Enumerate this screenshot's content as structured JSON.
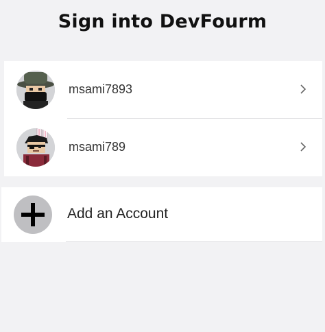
{
  "header": {
    "title": "Sign into DevFourm"
  },
  "accounts": [
    {
      "username": "msami7893",
      "avatar": "masked-avatar-with-hat"
    },
    {
      "username": "msami789",
      "avatar": "avatar-with-bunny-ears"
    }
  ],
  "add_account": {
    "label": "Add an Account",
    "icon": "plus-icon"
  },
  "icons": {
    "chevron": "chevron-right-icon"
  },
  "colors": {
    "background": "#f2f2f4",
    "card": "#ffffff",
    "separator": "#dcdcdf",
    "add_circle": "#bfbfc2"
  }
}
